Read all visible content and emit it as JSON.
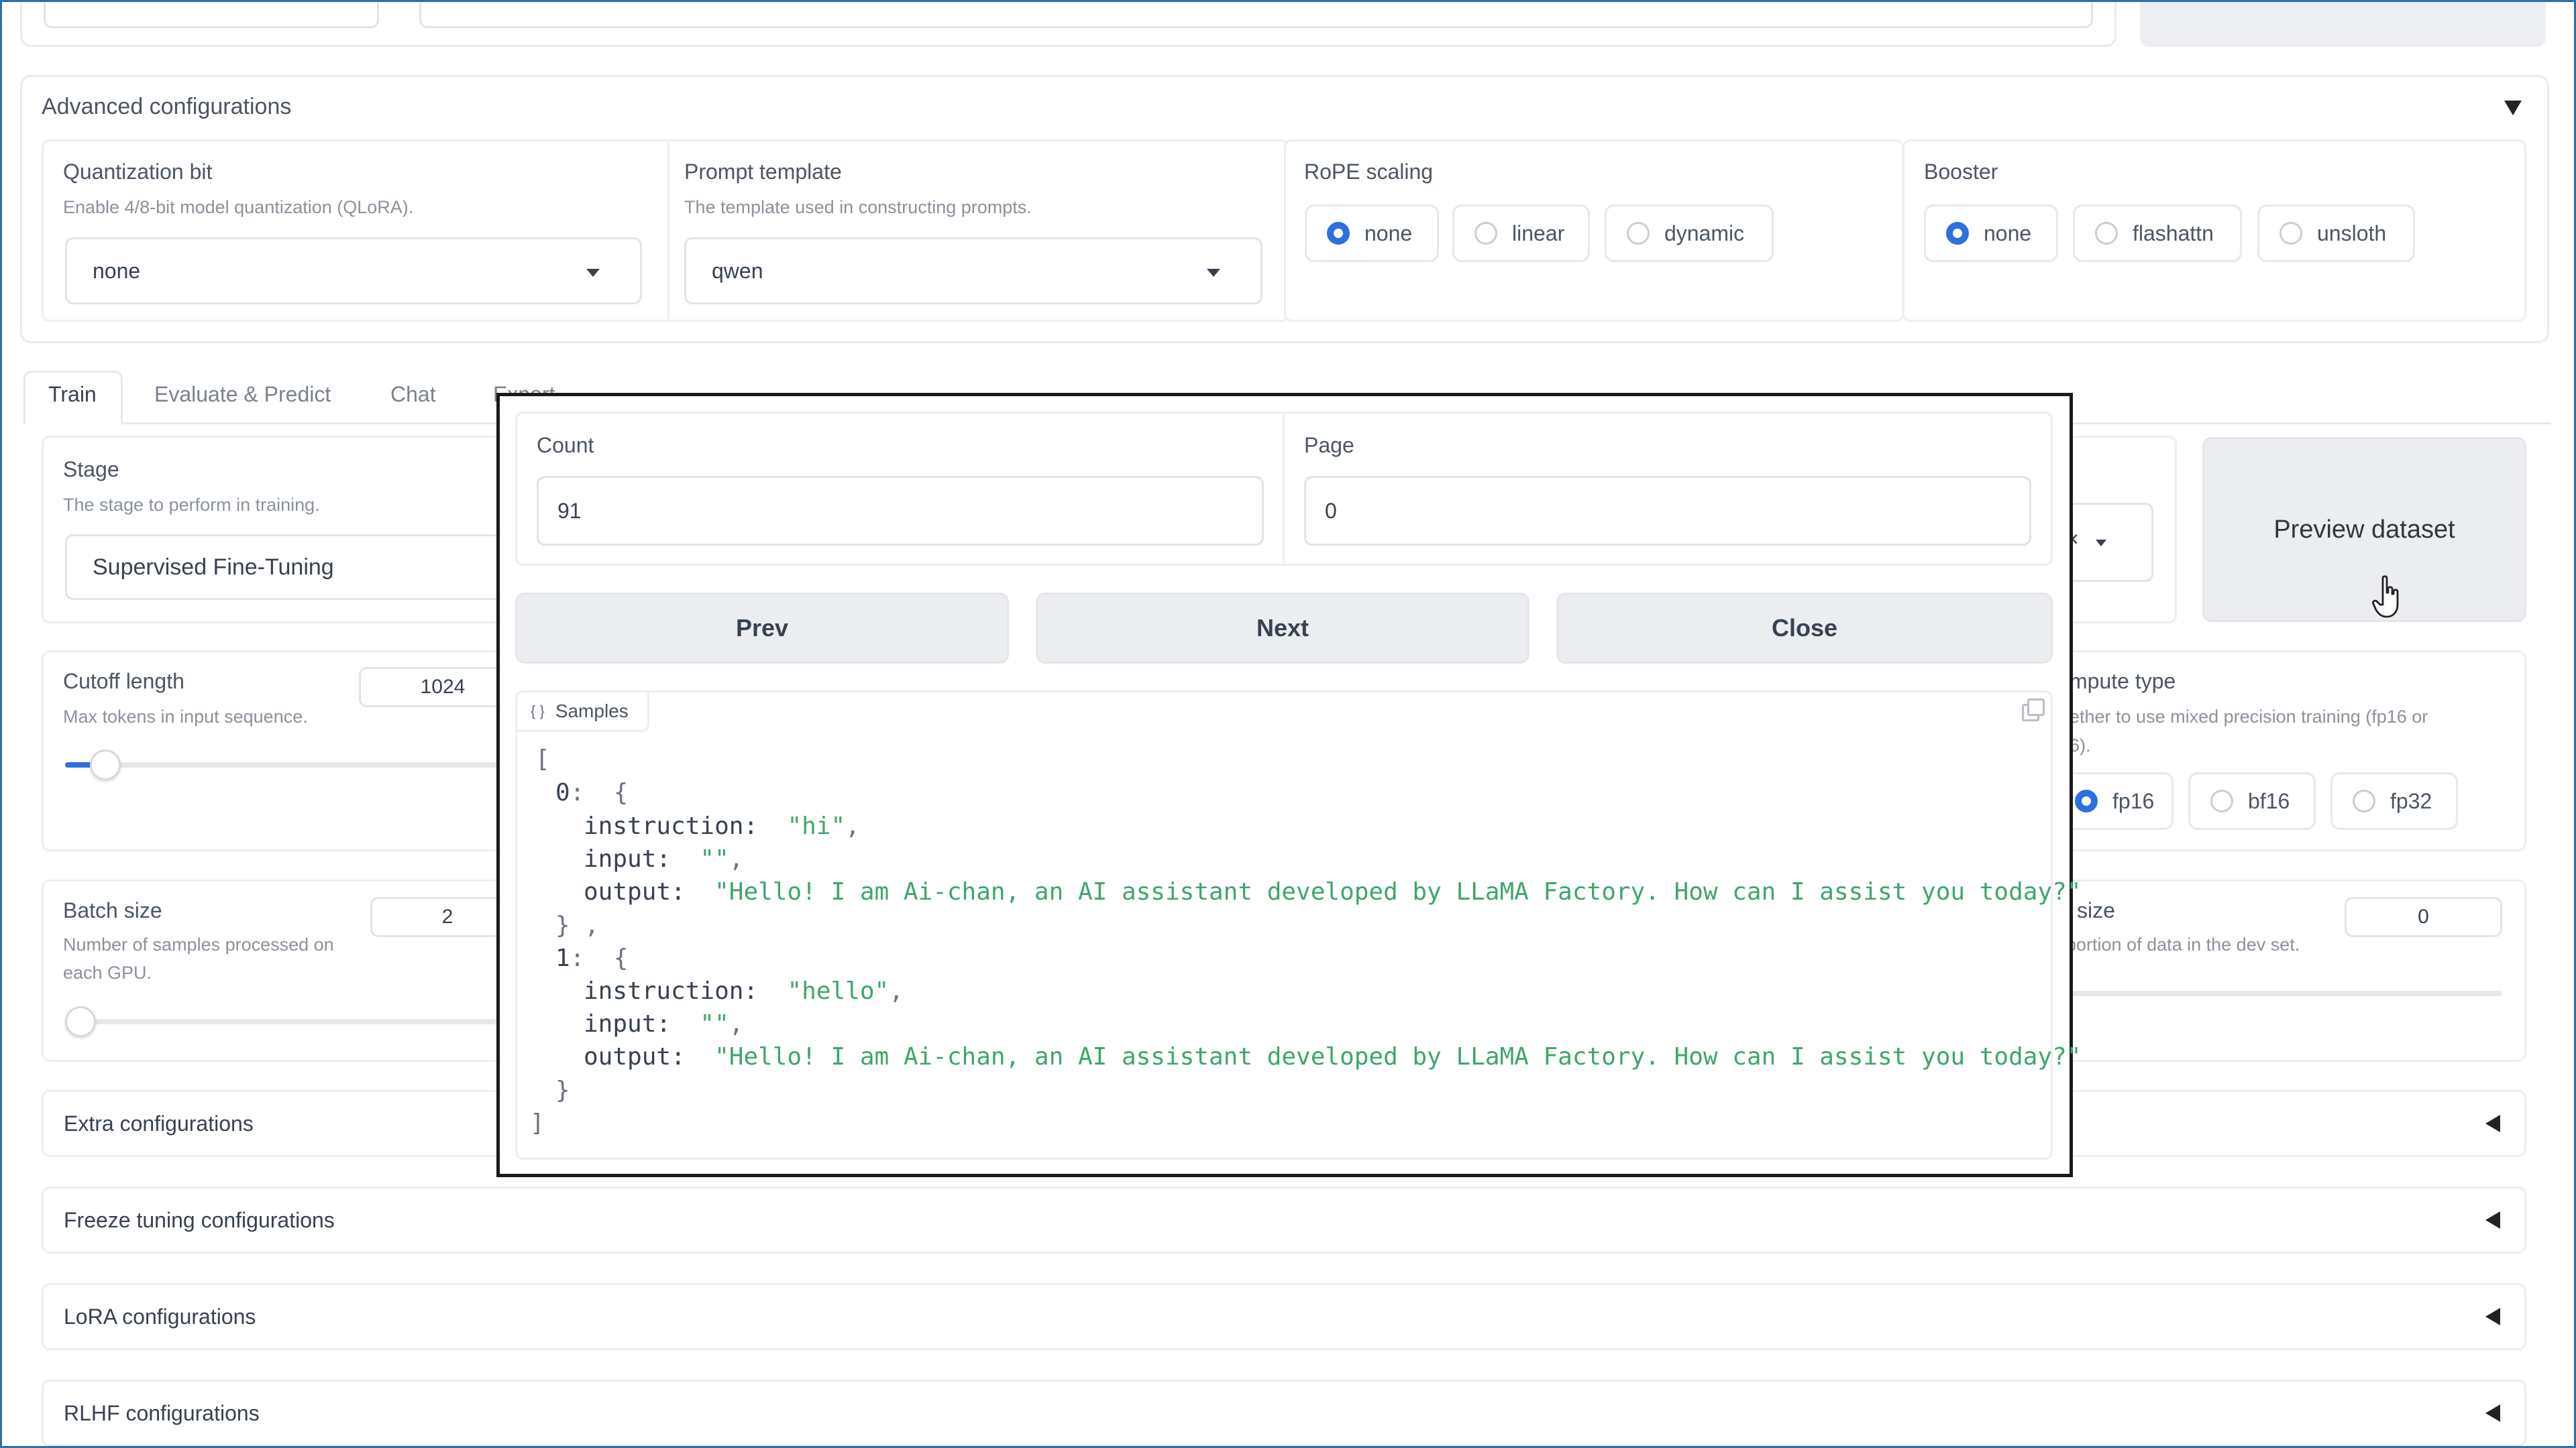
{
  "top_row": {},
  "advanced": {
    "title": "Advanced configurations",
    "quant": {
      "label": "Quantization bit",
      "info": "Enable 4/8-bit model quantization (QLoRA).",
      "value": "none"
    },
    "template": {
      "label": "Prompt template",
      "info": "The template used in constructing prompts.",
      "value": "qwen"
    },
    "rope": {
      "label": "RoPE scaling",
      "options": [
        "none",
        "linear",
        "dynamic"
      ],
      "selected": "none"
    },
    "booster": {
      "label": "Booster",
      "options": [
        "none",
        "flashattn",
        "unsloth"
      ],
      "selected": "none"
    }
  },
  "tabs": [
    "Train",
    "Evaluate & Predict",
    "Chat",
    "Export"
  ],
  "train": {
    "stage": {
      "label": "Stage",
      "info": "The stage to perform in training.",
      "value": "Supervised Fine-Tuning"
    },
    "cutoff": {
      "label": "Cutoff length",
      "info": "Max tokens in input sequence.",
      "value": "1024",
      "slider_fraction": 0.05
    },
    "batch": {
      "label": "Batch size",
      "info_line1": "Number of samples processed on",
      "info_line2": "each GPU.",
      "value": "2",
      "slider_fraction": 0.0
    },
    "dataset_clear": "×",
    "preview_button": "Preview dataset",
    "compute": {
      "label_partial": "mpute type",
      "info_line1": "ether to use mixed precision training (fp16 or",
      "info_line2": "6).",
      "options": [
        "fp16",
        "bf16",
        "fp32"
      ],
      "selected": "fp16"
    },
    "val": {
      "label_partial": "l size",
      "info_partial": "portion of data in the dev set.",
      "value": "0"
    }
  },
  "accordions": [
    "Extra configurations",
    "Freeze tuning configurations",
    "LoRA configurations",
    "RLHF configurations"
  ],
  "modal": {
    "count_label": "Count",
    "count_value": "91",
    "page_label": "Page",
    "page_value": "0",
    "prev": "Prev",
    "next": "Next",
    "close": "Close",
    "samples_label": "Samples",
    "samples_icon": "{ }",
    "samples": [
      {
        "index": "0",
        "instruction": "hi",
        "input": "",
        "output": "Hello! I am Ai-chan, an AI assistant developed by LLaMA Factory. How can I assist you today?"
      },
      {
        "index": "1",
        "instruction": "hello",
        "input": "",
        "output": "Hello! I am Ai-chan, an AI assistant developed by LLaMA Factory. How can I assist you today?"
      }
    ]
  }
}
